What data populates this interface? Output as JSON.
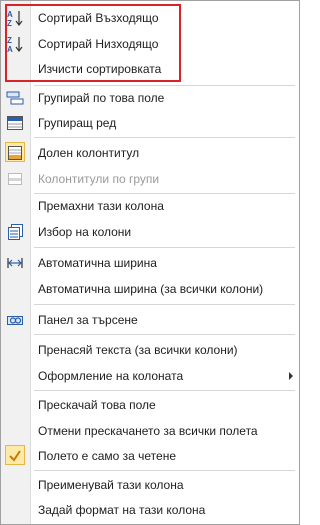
{
  "menu": {
    "items": [
      {
        "label": "Сортирай Възходящо",
        "icon": "sort-ascending-icon"
      },
      {
        "label": "Сортирай Низходящо",
        "icon": "sort-descending-icon"
      },
      {
        "label": "Изчисти сортировката",
        "icon": ""
      },
      {
        "label": "Групирай по това поле",
        "icon": "group-by-field-icon"
      },
      {
        "label": "Групиращ ред",
        "icon": "group-row-icon"
      },
      {
        "label": "Долен колонтитул",
        "icon": "footer-icon"
      },
      {
        "label": "Колонтитули по групи",
        "icon": "group-footer-icon"
      },
      {
        "label": "Премахни тази колона",
        "icon": ""
      },
      {
        "label": "Избор на колони",
        "icon": "column-chooser-icon"
      },
      {
        "label": "Автоматична ширина",
        "icon": "autofit-width-icon"
      },
      {
        "label": "Автоматична ширина (за всички колони)",
        "icon": ""
      },
      {
        "label": "Панел за търсене",
        "icon": "find-panel-icon"
      },
      {
        "label": "Пренасяй текста (за всички колони)",
        "icon": ""
      },
      {
        "label": "Оформление на колоната",
        "icon": "",
        "submenu": true
      },
      {
        "label": "Прескачай това поле",
        "icon": ""
      },
      {
        "label": "Отмени прескачането за всички полета",
        "icon": ""
      },
      {
        "label": "Полето е само за четене",
        "icon": "checkmark-icon",
        "checked": true
      },
      {
        "label": "Преименувай тази колона",
        "icon": ""
      },
      {
        "label": "Задай формат на тази колона",
        "icon": ""
      }
    ]
  },
  "colors": {
    "highlight_border": "#d8232a",
    "icon_blue": "#2b5fa8",
    "check_bg": "#fde9a8",
    "check_mark": "#c47f00",
    "disabled_text": "#9a9a9a"
  }
}
